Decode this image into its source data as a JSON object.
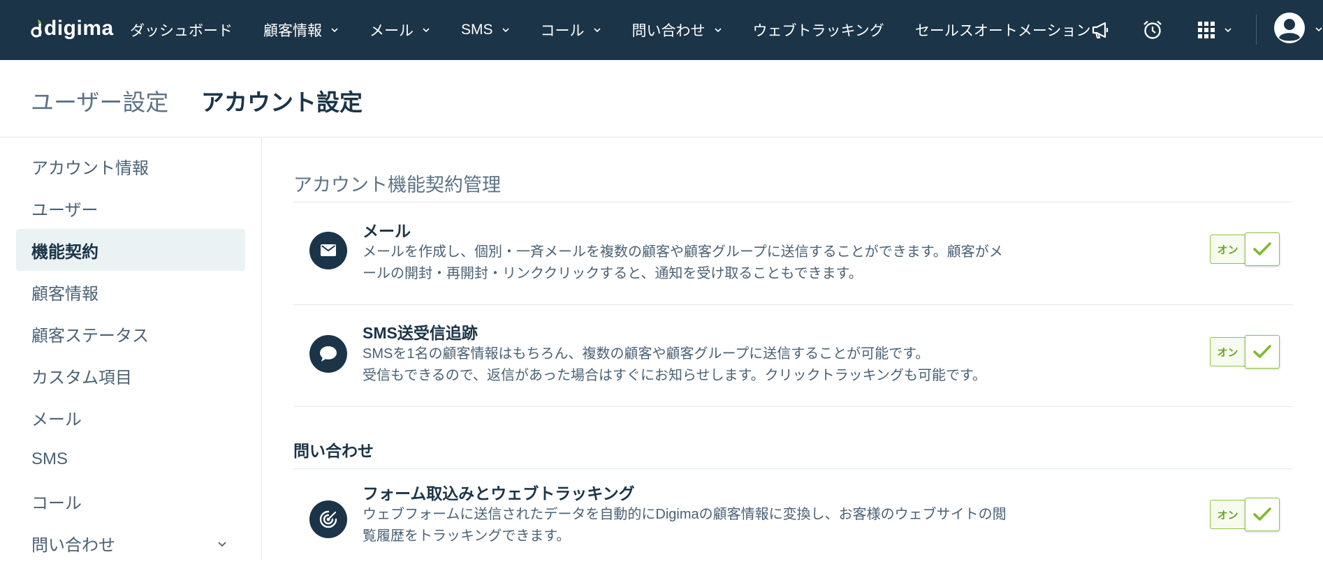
{
  "app": {
    "logo_text": "digima",
    "brand_color": "#8cc63f",
    "nav_bg_color": "#1b3447"
  },
  "nav": {
    "items": [
      {
        "label": "ダッシュボード",
        "has_dropdown": false
      },
      {
        "label": "顧客情報",
        "has_dropdown": true
      },
      {
        "label": "メール",
        "has_dropdown": true
      },
      {
        "label": "SMS",
        "has_dropdown": true
      },
      {
        "label": "コール",
        "has_dropdown": true
      },
      {
        "label": "問い合わせ",
        "has_dropdown": true
      },
      {
        "label": "ウェブトラッキング",
        "has_dropdown": false
      },
      {
        "label": "セールスオートメーション",
        "has_dropdown": false
      }
    ],
    "icons": [
      "megaphone-icon",
      "alarm-clock-icon",
      "apps-grid-icon",
      "user-avatar-icon"
    ]
  },
  "header": {
    "parent": "ユーザー設定",
    "current": "アカウント設定"
  },
  "sidebar": {
    "items": [
      {
        "label": "アカウント情報",
        "active": false
      },
      {
        "label": "ユーザー",
        "active": false
      },
      {
        "label": "機能契約",
        "active": true
      },
      {
        "label": "顧客情報",
        "active": false
      },
      {
        "label": "顧客ステータス",
        "active": false
      },
      {
        "label": "カスタム項目",
        "active": false
      },
      {
        "label": "メール",
        "active": false
      },
      {
        "label": "SMS",
        "active": false
      },
      {
        "label": "コール",
        "active": false
      },
      {
        "label": "問い合わせ",
        "active": false,
        "expandable": true
      }
    ]
  },
  "main": {
    "section_title": "アカウント機能契約管理",
    "features": [
      {
        "icon": "envelope-icon",
        "title": "メール",
        "desc_lines": [
          "メールを作成し、個別・一斉メールを複数の顧客や顧客グループに送信することができます。顧客がメ",
          "ールの開封・再開封・リンククリックすると、通知を受け取ることもできます。"
        ],
        "toggle_label": "オン",
        "enabled": true
      },
      {
        "icon": "speech-bubble-icon",
        "title": "SMS送受信追跡",
        "desc_lines": [
          "SMSを1名の顧客情報はもちろん、複数の顧客や顧客グループに送信することが可能です。",
          "受信もできるので、返信があった場合はすぐにお知らせします。クリックトラッキングも可能です。"
        ],
        "toggle_label": "オン",
        "enabled": true
      }
    ],
    "subsection": {
      "title": "問い合わせ",
      "features": [
        {
          "icon": "tracking-target-icon",
          "title": "フォーム取込みとウェブトラッキング",
          "desc_lines": [
            "ウェブフォームに送信されたデータを自動的にDigimaの顧客情報に変換し、お客様のウェブサイトの閲",
            "覧履歴をトラッキングできます。"
          ],
          "toggle_label": "オン",
          "enabled": true
        }
      ]
    }
  }
}
